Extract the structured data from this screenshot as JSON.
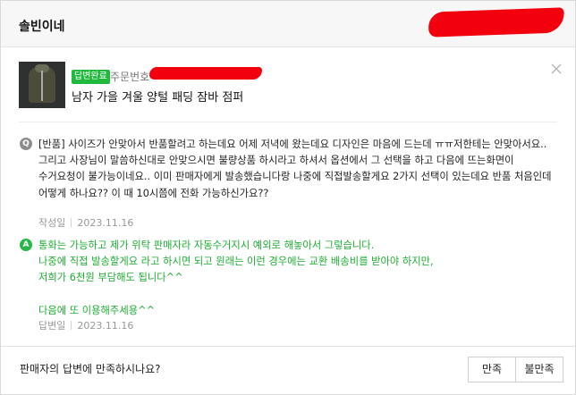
{
  "header": {
    "store_name": "솔빈이네"
  },
  "product": {
    "badge": "답변완료",
    "order_label": "주문번호",
    "title": "남자 가을 겨울 양털 패딩 잠바 점퍼"
  },
  "question": {
    "icon_letter": "Q",
    "text": "[반품] 사이즈가 안맞아서 반품할려고 하는데요 어제 저녁에 왔는데요 디자인은 마음에 드는데 ㅠㅠ저한테는 안맞아서요.. 그리고 사장님이 말씀하신대로 안맞으시면 불량상품 하시라고 하셔서 옵션에서 그 선택을 하고 다음에 뜨는화면이 수거요청이 불가능이네요.. 이미 판매자에게 발송했습니다랑 나중에 직접발송할게요 2가지 선택이 있는데요 반품 처음인데 어떻게 하나요?? 이 때 10시쯤에 전화 가능하신가요??",
    "date_label": "작성일",
    "date": "2023.11.16"
  },
  "answer": {
    "icon_letter": "A",
    "text": "통화는 가능하고 제가 위탁 판매자라 자동수거지시 예외로 해놓아서 그렇습니다.\n나중에 직접 발송할게요 라고 하시면 되고 원래는 이런 경우에는 교환 배송비를 받아야 하지만,\n저희가 6천원 부담해도 됩니다^^\n\n다음에 또 이용해주세용^^",
    "date_label": "답변일",
    "date": "2023.11.16"
  },
  "footer": {
    "question": "판매자의 답변에 만족하시나요?",
    "yes_label": "만족",
    "no_label": "불만족"
  },
  "colors": {
    "accent_green": "#1fb93b",
    "answer_text": "#1dad32",
    "redaction": "#f2000d"
  }
}
